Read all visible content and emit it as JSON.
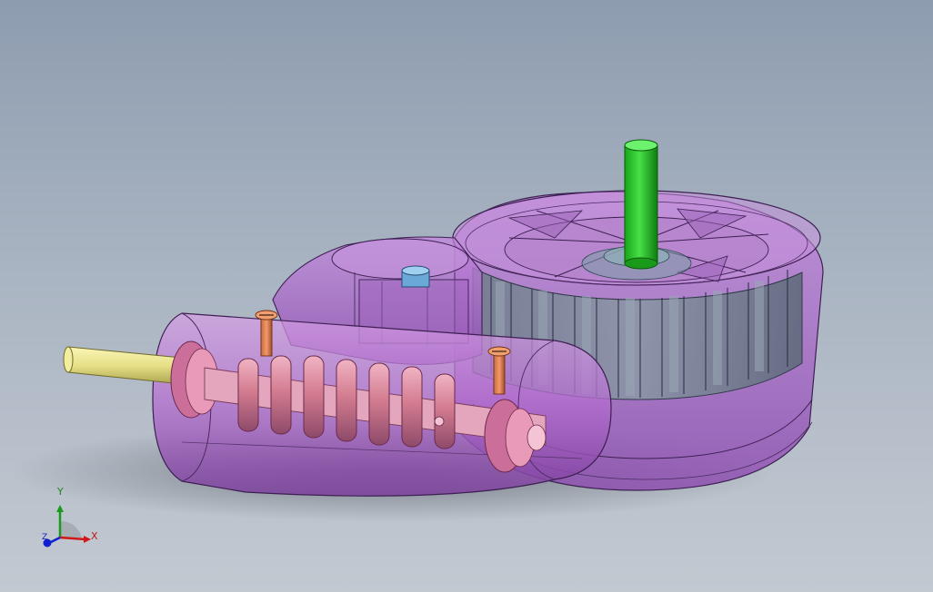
{
  "viewport": {
    "background_top": "#8d9caf",
    "background_bottom": "#c3c9d1",
    "display_mode": "shaded-transparent"
  },
  "model": {
    "parts": [
      {
        "name": "housing",
        "color": "#b06ad0"
      },
      {
        "name": "worm-wheel",
        "color": "#7a8a9a"
      },
      {
        "name": "worm-shaft",
        "color": "#d88aa0"
      },
      {
        "name": "input-shaft",
        "color": "#e8e28a"
      },
      {
        "name": "output-shaft",
        "color": "#26c026"
      },
      {
        "name": "screw-left",
        "color": "#e08050"
      },
      {
        "name": "screw-right",
        "color": "#e08050"
      },
      {
        "name": "plug",
        "color": "#6aa8d8"
      }
    ]
  },
  "triad": {
    "x_label": "X",
    "y_label": "Y",
    "z_label": "Z",
    "x_color": "#d01818",
    "y_color": "#1a9a1a",
    "z_color": "#1020d0"
  }
}
